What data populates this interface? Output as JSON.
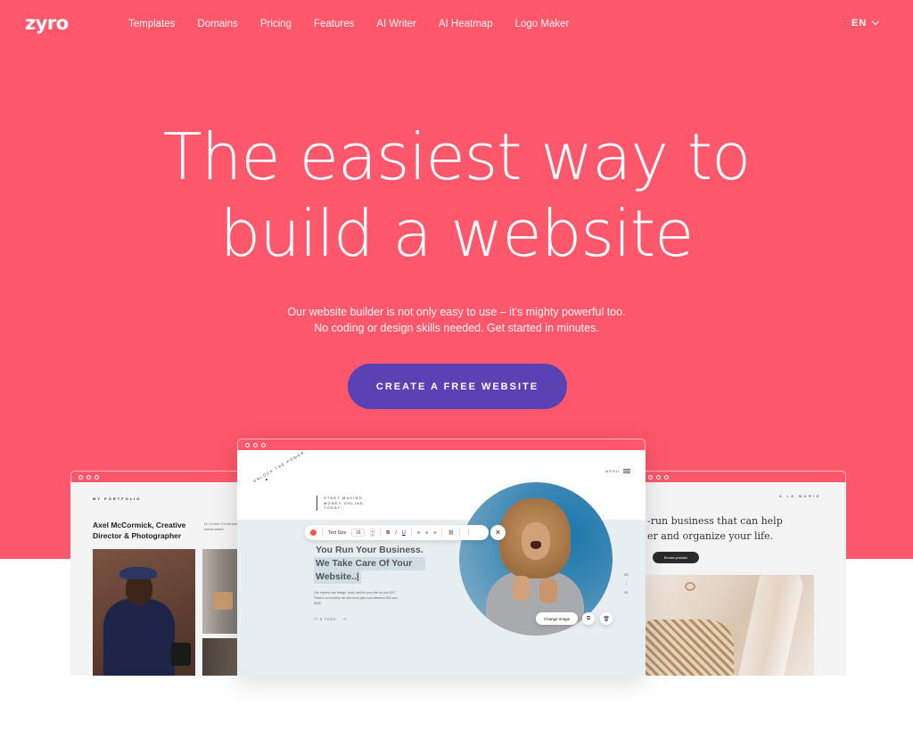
{
  "header": {
    "logo": "zyro",
    "nav": [
      {
        "label": "Templates"
      },
      {
        "label": "Domains"
      },
      {
        "label": "Pricing"
      },
      {
        "label": "Features"
      },
      {
        "label": "AI Writer"
      },
      {
        "label": "AI Heatmap"
      },
      {
        "label": "Logo Maker"
      }
    ],
    "language": "EN"
  },
  "hero": {
    "title_line1": "The easiest way to",
    "title_line2": "build a website",
    "subtitle_line1": "Our website builder is not only easy to use – it’s mighty powerful too.",
    "subtitle_line2": "No coding or design skills needed. Get started in minutes.",
    "cta_label": "CREATE A FREE WEBSITE"
  },
  "colors": {
    "brand": "#ff576b",
    "cta": "#5a42b5"
  },
  "preview_left": {
    "kicker": "MY PORTFOLIO",
    "name": "Axel McCormick, Creative Director & Photographer",
    "bio": "Hi, I'm Axel. For the past ... hospitality brands achiev..."
  },
  "preview_center": {
    "badge_text": "UNLOCK THE POWER",
    "menu_label": "MENU",
    "tagline": [
      "START MAKING",
      "MONEY ONLINE.",
      "TODAY"
    ],
    "toolbar": {
      "text_size_label": "Text Size",
      "text_size_value": "16",
      "bold": "B",
      "italic": "I",
      "underline": "U"
    },
    "headline": [
      "You Run Your Business.",
      "We Take Care Of Your",
      "Website..|"
    ],
    "paragraph": "Our experts can design, build, and fix your site for you 24/7. There's no monthly fee and most jobs cost between $20 and $150.",
    "free_link": "IT'S FREE",
    "slide_counter": [
      "03",
      "/",
      "10"
    ],
    "change_image_label": "Change image"
  },
  "preview_right": {
    "brand": "A LA MARIE",
    "headline_line1": "-run business that can help",
    "headline_line2": "er and organize your life.",
    "browse_label": "Browse products"
  }
}
